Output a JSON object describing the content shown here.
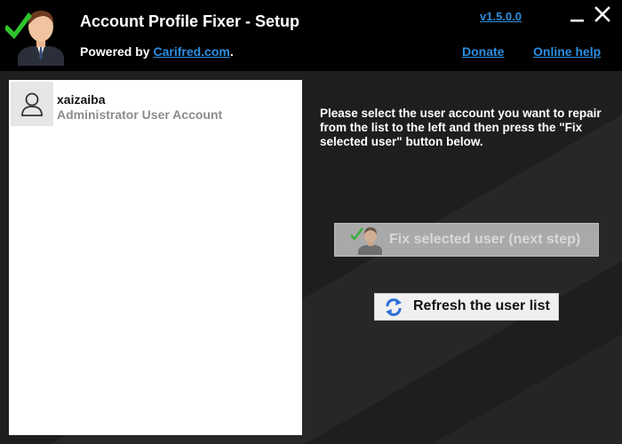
{
  "window": {
    "title": "Account Profile Fixer - Setup",
    "version": "v1.5.0.0",
    "powered_prefix": "Powered by ",
    "powered_link": "Carifred.com",
    "powered_suffix": ".",
    "donate_label": "Donate",
    "help_label": "Online help",
    "logo_icon": "user-check-logo-icon",
    "minimize_icon": "minimize-icon",
    "close_icon": "close-icon"
  },
  "user_list": {
    "items": [
      {
        "name": "xaizaiba",
        "type": "Administrator User Account",
        "icon": "user-icon"
      }
    ]
  },
  "main": {
    "instructions": "Please select the user account you want to repair from the list to the left and then press the \"Fix selected user\" button below.",
    "fix_button_label": "Fix selected user (next step)",
    "fix_button_enabled": false,
    "refresh_button_label": "Refresh the user list"
  },
  "colors": {
    "accent_link": "#2d8fe0",
    "check_green": "#2ec42e",
    "background": "#000000",
    "panel": "#1e1e1e"
  }
}
